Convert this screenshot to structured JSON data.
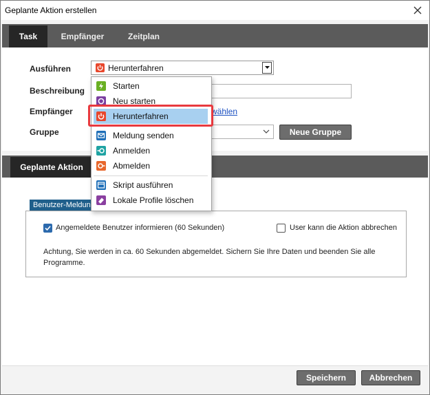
{
  "window": {
    "title": "Geplante Aktion erstellen"
  },
  "tabs": [
    {
      "label": "Task",
      "active": true
    },
    {
      "label": "Empfänger",
      "active": false
    },
    {
      "label": "Zeitplan",
      "active": false
    }
  ],
  "form": {
    "ausfuehren_label": "Ausführen",
    "ausfuehren_value": "Herunterfahren",
    "beschreibung_label": "Beschreibung",
    "empfaenger_label": "Empfänger",
    "empfaenger_link_partial": "wählen",
    "gruppe_label": "Gruppe",
    "neue_gruppe_button": "Neue Gruppe"
  },
  "dropdown": {
    "items": [
      {
        "label": "Starten",
        "icon": "start-icon",
        "color": "#6ab023"
      },
      {
        "label": "Neu starten",
        "icon": "restart-icon",
        "color": "#7b3fa0"
      },
      {
        "label": "Herunterfahren",
        "icon": "power-icon",
        "color": "#e8472c",
        "selected": true
      },
      {
        "label": "Meldung senden",
        "icon": "message-icon",
        "color": "#1f6fb8"
      },
      {
        "label": "Anmelden",
        "icon": "login-icon",
        "color": "#1fa3a3"
      },
      {
        "label": "Abmelden",
        "icon": "logout-icon",
        "color": "#e8672c"
      },
      {
        "label": "Skript ausführen",
        "icon": "script-icon",
        "color": "#1f6fb8"
      },
      {
        "label": "Lokale Profile löschen",
        "icon": "eraser-icon",
        "color": "#8a3fa0"
      }
    ]
  },
  "section": {
    "title": "Geplante Aktion",
    "legend": "Benutzer-Meldun",
    "notify_label": "Angemeldete Benutzer informieren (60 Sekunden)",
    "notify_checked": true,
    "cancel_allowed_label": "User kann die Aktion abbrechen",
    "cancel_allowed_checked": false,
    "warning_text": "Achtung, Sie werden in ca. 60 Sekunden abgemeldet. Sichern Sie Ihre Daten und beenden Sie alle Programme."
  },
  "footer": {
    "save_label": "Speichern",
    "cancel_label": "Abbrechen"
  },
  "colors": {
    "accent_highlight": "#e8393e",
    "selection": "#a8d0f0",
    "tab_bar": "#5b5b5b",
    "tab_active": "#262626",
    "legend_bg": "#1f5f8b"
  }
}
